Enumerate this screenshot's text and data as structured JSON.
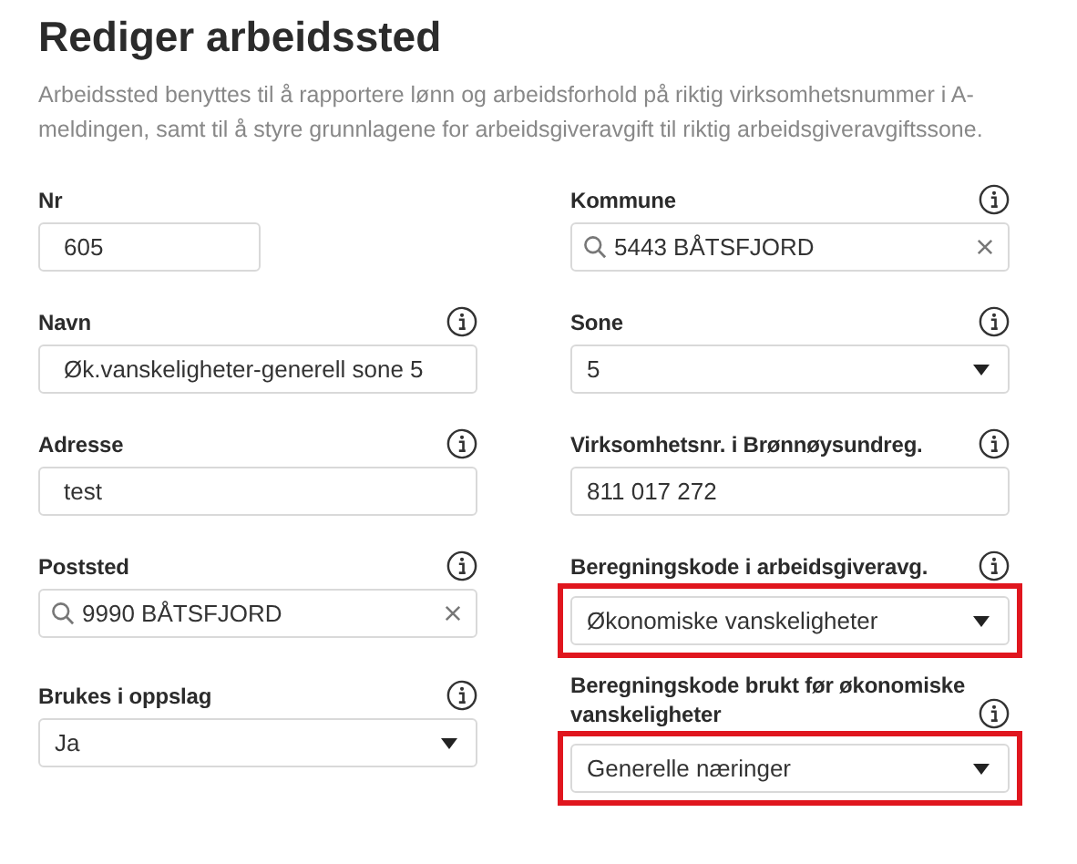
{
  "title": "Rediger arbeidssted",
  "description": "Arbeidssted benyttes til å rapportere lønn og arbeidsforhold på riktig virksomhetsnummer i A-meldingen, samt til å styre grunnlagene for arbeidsgiveravgift til riktig arbeidsgiveravgiftssone.",
  "fields": [
    {
      "label": "Nr",
      "kind": "short",
      "value": "605",
      "info": false,
      "highlighted": false
    },
    {
      "label": "Kommune",
      "kind": "search",
      "value": "5443 BÅTSFJORD",
      "info": true,
      "highlighted": false
    },
    {
      "label": "Navn",
      "kind": "text",
      "value": "Øk.vanskeligheter-generell sone 5",
      "info": true,
      "highlighted": false
    },
    {
      "label": "Sone",
      "kind": "select",
      "value": "5",
      "info": true,
      "highlighted": false
    },
    {
      "label": "Adresse",
      "kind": "text",
      "value": "test",
      "info": true,
      "highlighted": false
    },
    {
      "label": "Virksomhetsnr. i Brønnøysundreg.",
      "kind": "plain",
      "value": "811 017 272",
      "info": true,
      "highlighted": false
    },
    {
      "label": "Poststed",
      "kind": "search",
      "value": "9990 BÅTSFJORD",
      "info": true,
      "highlighted": false
    },
    {
      "label": "Beregningskode i arbeidsgiveravg.",
      "kind": "select",
      "value": "Økonomiske vanskeligheter",
      "info": true,
      "highlighted": true
    },
    {
      "label": "Brukes i oppslag",
      "kind": "select",
      "value": "Ja",
      "info": true,
      "highlighted": false
    },
    {
      "label": "Beregningskode brukt før økonomiske vanskeligheter",
      "kind": "select",
      "value": "Generelle næringer",
      "info": true,
      "highlighted": true
    }
  ]
}
